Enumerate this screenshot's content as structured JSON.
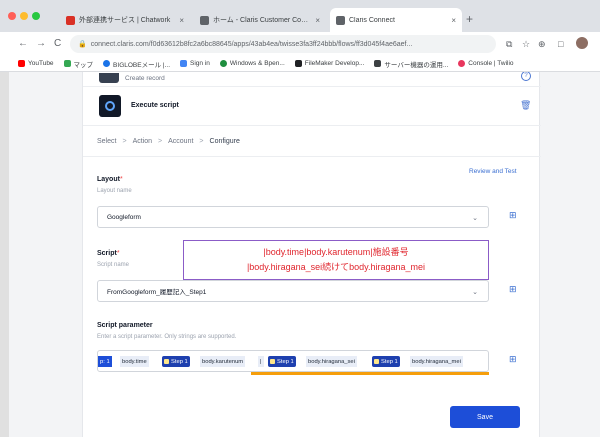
{
  "browser": {
    "tabs": [
      {
        "title": "外部連携サービス | Chatwork",
        "fav_color": "#d93025",
        "active": false
      },
      {
        "title": "ホーム - Claris Customer Cons...",
        "fav_color": "#5f6368",
        "active": false
      },
      {
        "title": "Claris Connect",
        "fav_color": "#5f6368",
        "active": true
      }
    ],
    "tab_close": "×",
    "new_tab": "+",
    "nav": {
      "back": "←",
      "forward": "→",
      "reload": "C"
    },
    "url": "connect.claris.com/f0d63612b8fc2a6bc88645/apps/43ab4ea/twisse3fa3ff24bbb/flows/ff3d045f4ae6aef...",
    "lock": "🔒",
    "toolbar_icons": [
      "⧉",
      "☆",
      "⊕",
      "□"
    ],
    "bookmarks": [
      {
        "label": "YouTube",
        "color": "#ff0000"
      },
      {
        "label": "マップ",
        "color": "#34a853"
      },
      {
        "label": "BIGLOBEメール |...",
        "color": "#1a73e8"
      },
      {
        "label": "Sign in",
        "color": "#4285f4"
      },
      {
        "label": "Windows & Bpen...",
        "color": "#1e8e3e"
      },
      {
        "label": "FileMaker Develop...",
        "color": "#202124"
      },
      {
        "label": "サーバー機器の運用...",
        "color": "#3c4043"
      },
      {
        "label": "Console | Twilio",
        "color": "#e8365d"
      }
    ]
  },
  "app": {
    "prev_step_label": "Create record",
    "help_icon": "?",
    "step_title": "Execute script",
    "trash_icon": "🗑",
    "breadcrumbs": [
      "Select",
      "Action",
      "Account",
      "Configure"
    ],
    "breadcrumb_sep": ">",
    "review_link": "Review and Test",
    "layout": {
      "label": "Layout",
      "required": "*",
      "hint": "Layout name",
      "value": "Googleform"
    },
    "script": {
      "label": "Script",
      "required": "*",
      "hint": "Script name",
      "value": "FromGoogleform_履歴記入_Step1"
    },
    "parameter": {
      "label": "Script parameter",
      "hint": "Enter a script parameter. Only strings are supported.",
      "chips": [
        {
          "type": "hl",
          "text": "p: 1"
        },
        {
          "type": "txt",
          "text": "body.time"
        },
        {
          "type": "step",
          "text": "Step 1"
        },
        {
          "type": "txt",
          "text": "body.karutenum"
        },
        {
          "type": "txt",
          "text": "|"
        },
        {
          "type": "step",
          "text": "Step 1"
        },
        {
          "type": "txt",
          "text": "body.hiragana_sei"
        },
        {
          "type": "step",
          "text": "Step 1"
        },
        {
          "type": "txt",
          "text": "body.hiragana_mei"
        }
      ]
    },
    "save_label": "Save",
    "side_plus_icon": "⊞",
    "annotation": {
      "line1": "|body.time|body.karutenum|施設番号",
      "line2": "|body.hiragana_sei続けてbody.hiragana_mei"
    },
    "colors": {
      "accent": "#1d4ed8",
      "annotation_border": "#8b5cc7",
      "annotation_text": "#e0262e",
      "highlight_underline": "#f59e0b"
    }
  }
}
